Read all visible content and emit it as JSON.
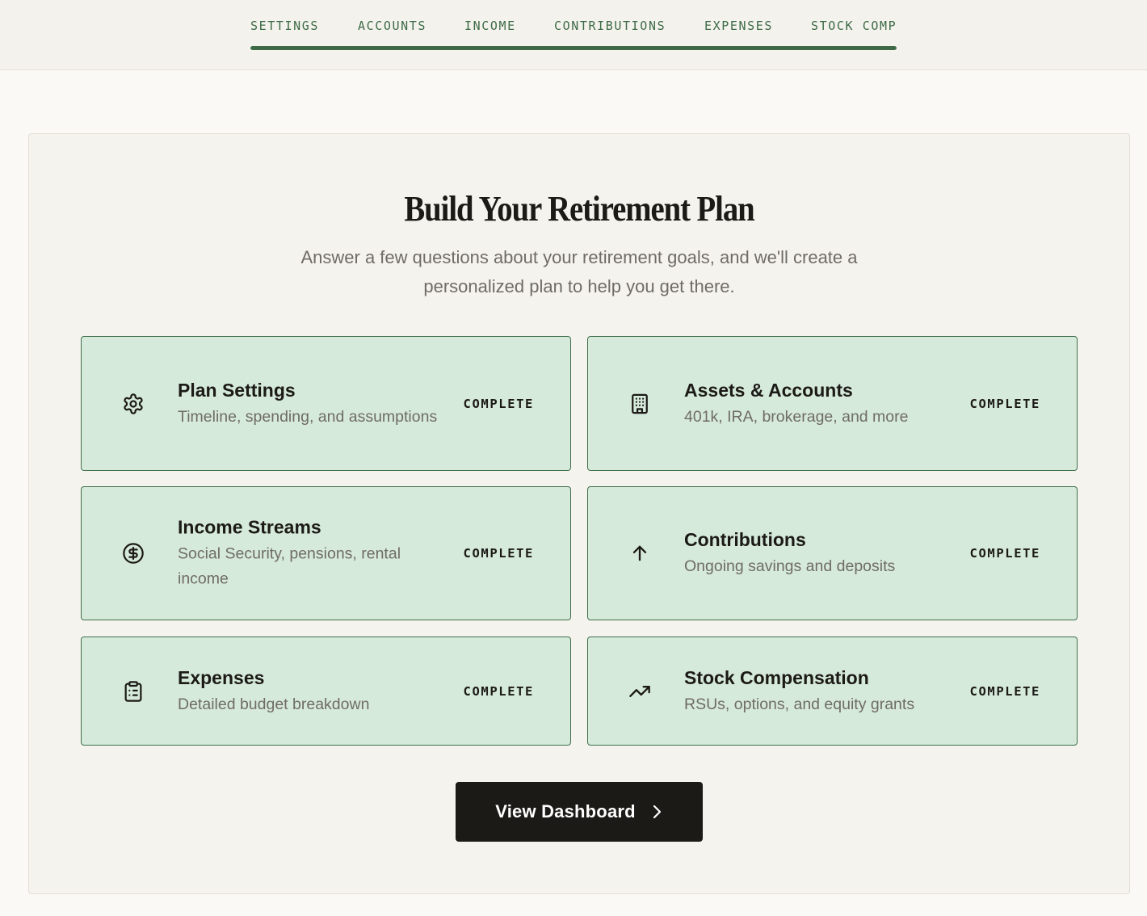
{
  "nav": {
    "tabs": [
      {
        "label": "SETTINGS"
      },
      {
        "label": "ACCOUNTS"
      },
      {
        "label": "INCOME"
      },
      {
        "label": "CONTRIBUTIONS"
      },
      {
        "label": "EXPENSES"
      },
      {
        "label": "STOCK COMP"
      }
    ],
    "progress_fraction": 1.0,
    "accent_color": "#3f6a48"
  },
  "main": {
    "title": "Build Your Retirement Plan",
    "subtitle": "Answer a few questions about your retirement goals, and we'll create a personalized plan to help you get there.",
    "cards": [
      {
        "icon": "gear-icon",
        "title": "Plan Settings",
        "description": "Timeline, spending, and assumptions",
        "status": "COMPLETE"
      },
      {
        "icon": "building-icon",
        "title": "Assets & Accounts",
        "description": "401k, IRA, brokerage, and more",
        "status": "COMPLETE"
      },
      {
        "icon": "dollar-circle-icon",
        "title": "Income Streams",
        "description": "Social Security, pensions, rental income",
        "status": "COMPLETE"
      },
      {
        "icon": "arrow-up-icon",
        "title": "Contributions",
        "description": "Ongoing savings and deposits",
        "status": "COMPLETE"
      },
      {
        "icon": "clipboard-list-icon",
        "title": "Expenses",
        "description": "Detailed budget breakdown",
        "status": "COMPLETE"
      },
      {
        "icon": "trending-up-icon",
        "title": "Stock Compensation",
        "description": "RSUs, options, and equity grants",
        "status": "COMPLETE"
      }
    ],
    "card_color": "#d6eadb",
    "card_border_color": "#3f6f4b",
    "cta": {
      "label": "View Dashboard",
      "icon": "chevron-right-icon",
      "color": "#1c1a16"
    }
  }
}
